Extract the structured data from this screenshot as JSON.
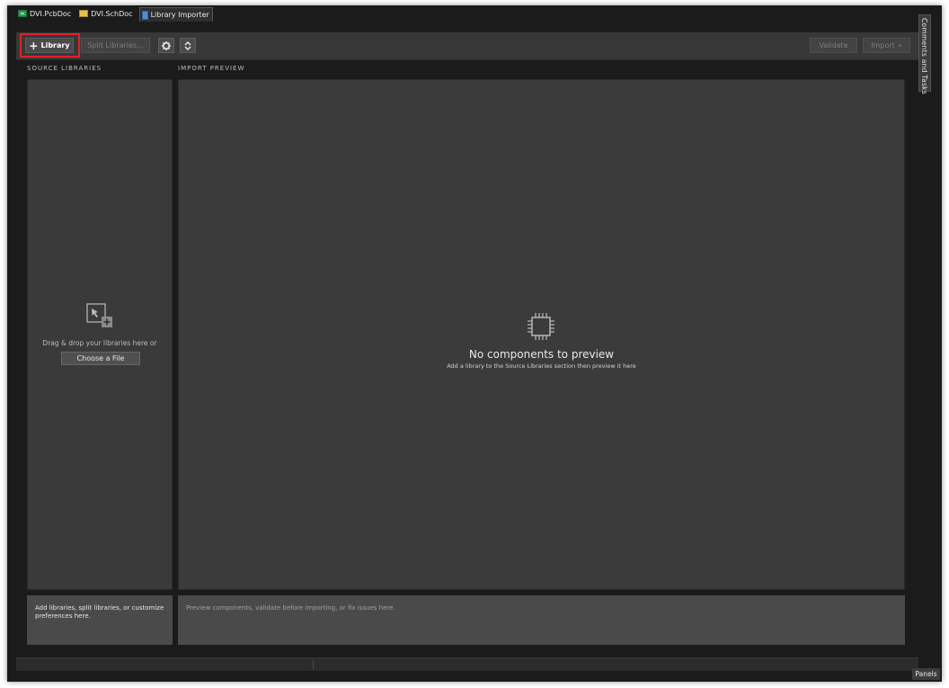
{
  "tabs": [
    {
      "label": "DVI.PcbDoc",
      "icon": "pcb-document-icon"
    },
    {
      "label": "DVI.SchDoc",
      "icon": "schematic-document-icon"
    },
    {
      "label": "Library Importer",
      "icon": "library-importer-icon",
      "active": true
    }
  ],
  "toolbar": {
    "add_library_label": "Library",
    "add_icon": "+",
    "split_label": "Split Libraries...",
    "settings_icon": "gear-icon",
    "sort_icon": "sort-icon",
    "validate_label": "Validate",
    "import_label": "Import",
    "import_icon": "»"
  },
  "sections": {
    "source_heading": "SOURCE LIBRARIES",
    "preview_heading": "IMPORT PREVIEW"
  },
  "source": {
    "drop_text": "Drag & drop your libraries here or",
    "choose_label": "Choose a File",
    "footer": "Add libraries, split libraries, or customize preferences here."
  },
  "preview": {
    "empty_title": "No components to preview",
    "empty_subtitle": "Add a library to the Source Libraries section then preview it here",
    "footer": "Preview components, validate before importing, or fix issues here."
  },
  "side_panel": {
    "label": "Comments and Tasks"
  },
  "statusbar": {
    "panels_label": "Panels"
  },
  "colors": {
    "highlight": "#e2202a",
    "background": "#3b3b3b",
    "toolbar": "#383838"
  }
}
